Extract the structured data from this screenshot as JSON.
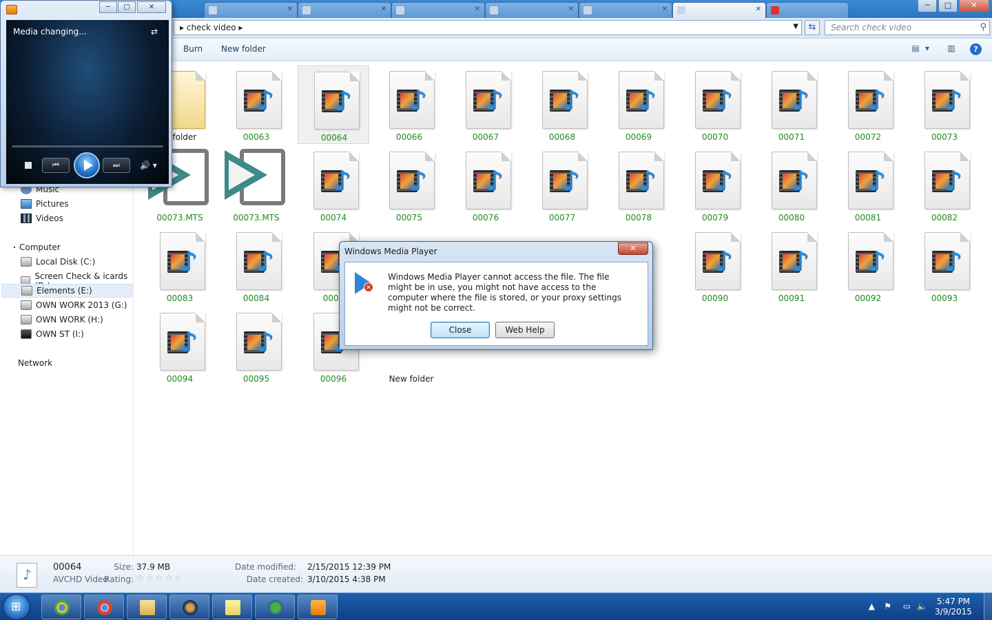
{
  "explorer": {
    "breadcrumb": "check video",
    "search_placeholder": "Search check video",
    "toolbar": {
      "burn": "Burn",
      "new_folder": "New folder",
      "help": "?"
    },
    "nav": {
      "libraries": [
        "Music",
        "Pictures",
        "Videos"
      ],
      "computer": "Computer",
      "drives": [
        "Local Disk (C:)",
        "Screen Check & icards (D:)",
        "Elements (E:)",
        "OWN WORK 2013 (G:)",
        "OWN WORK (H:)",
        "OWN ST (I:)"
      ],
      "network": "Network"
    },
    "files": {
      "row1": [
        "w folder",
        "00063",
        "00064",
        "00066",
        "00067",
        "00068",
        "00069",
        "00070",
        "00071",
        "00072",
        "00073"
      ],
      "row2": [
        "00073.MTS",
        "00073.MTS",
        "00074",
        "00075",
        "00076",
        "00077",
        "00078",
        "00079",
        "00080",
        "00081",
        "00082"
      ],
      "row3": [
        "00083",
        "00084",
        "0008",
        "00090",
        "00091",
        "00092",
        "00093"
      ],
      "row4": [
        "00094",
        "00095",
        "00096",
        "New folder"
      ]
    },
    "details": {
      "name": "00064",
      "type": "AVCHD Video",
      "size_label": "Size:",
      "size": "37.9 MB",
      "rating_label": "Rating:",
      "rating_stars": "☆☆☆☆☆",
      "modified_label": "Date modified:",
      "modified": "2/15/2015 12:39 PM",
      "created_label": "Date created:",
      "created": "3/10/2015 4:38 PM"
    }
  },
  "media_player": {
    "status": "Media changing...",
    "prev": "⏮",
    "next": "⏭",
    "volume": "🔊 ▾"
  },
  "dialog": {
    "title": "Windows Media Player",
    "message": "Windows Media Player cannot access the file. The file might be in use, you might not have access to the computer where the file is stored, or your proxy settings might not be correct.",
    "close_label": "Close",
    "webhelp_label": "Web Help",
    "x": "✕"
  },
  "taskbar": {
    "time": "5:47 PM",
    "date": "3/9/2015"
  },
  "colors": {
    "file_label": "#1e8a1e",
    "accent": "#2a6bc7"
  }
}
